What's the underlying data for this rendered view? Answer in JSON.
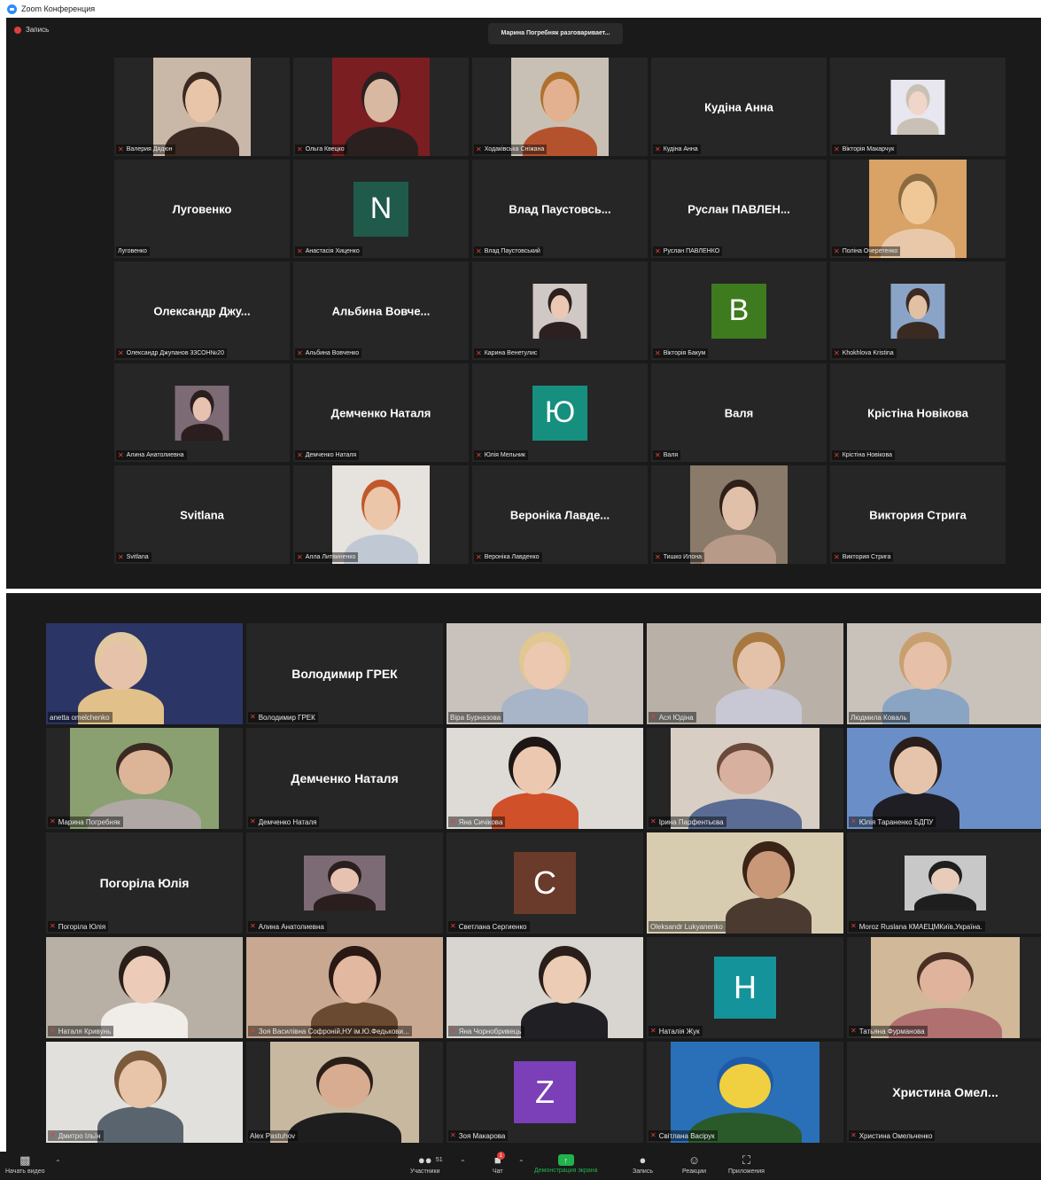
{
  "window": {
    "title": "Zoom Конференция"
  },
  "screen1": {
    "recording_label": "Запись",
    "speaking_banner": "Марина Погребняк разговаривает...",
    "tiles": [
      {
        "type": "photo",
        "name": "Валерия Дядюн",
        "bg": "#c9b8a8",
        "skin": "#e8c4a8",
        "hair": "#3a2a22"
      },
      {
        "type": "photo",
        "name": "Ольга Квецко",
        "bg": "#7a1e22",
        "skin": "#d8b8a0",
        "hair": "#2a2020"
      },
      {
        "type": "photo",
        "name": "Ходаківська Сніжана",
        "bg": "#c8c0b4",
        "skin": "#e3b190",
        "hair": "#b0702e",
        "shirt": "#b5522e"
      },
      {
        "type": "text",
        "big": "Кудіна Анна",
        "name": "Кудіна Анна"
      },
      {
        "type": "photo",
        "name": "Вікторія Макарчук",
        "bg": "#e8e6ee",
        "skin": "#f0d6c8",
        "hair": "#c9c1b5",
        "small": true
      },
      {
        "type": "text",
        "big": "Луговенко",
        "name": "Луговенко",
        "nomic": true
      },
      {
        "type": "letter",
        "letter": "N",
        "color": "#1f5a4a",
        "name": "Анастасія Хиценко"
      },
      {
        "type": "text",
        "big": "Влад Паустовсь...",
        "name": "Влад Паустовський"
      },
      {
        "type": "text",
        "big": "Руслан ПАВЛЕН...",
        "name": "Руслан ПАВЛЕНКО"
      },
      {
        "type": "photo",
        "name": "Поліна Очеретенко",
        "bg": "#d9a266",
        "skin": "#f0c898",
        "hair": "#8a6a40",
        "shirt": "#e8c8a8"
      },
      {
        "type": "text",
        "big": "Олександр Джу...",
        "name": "Олександр Джупанов 33СОН№20"
      },
      {
        "type": "text",
        "big": "Альбина Вовче...",
        "name": "Альбина Вовченко"
      },
      {
        "type": "photo",
        "name": "Карина Венетулис",
        "bg": "#d0c8c4",
        "skin": "#ecc8b4",
        "hair": "#2c2020",
        "small": true
      },
      {
        "type": "letter",
        "letter": "B",
        "color": "#3e7a1e",
        "name": "Вікторія Бакум"
      },
      {
        "type": "photo",
        "name": "Khokhlova Kristina",
        "bg": "#8aa4c8",
        "skin": "#e2c0a4",
        "hair": "#3a2a22",
        "small": true
      },
      {
        "type": "photo",
        "name": "Алина Анатолиевна",
        "bg": "#7c6a74",
        "skin": "#e8c2b0",
        "hair": "#2a1e1e",
        "small": true
      },
      {
        "type": "text",
        "big": "Демченко Наталя",
        "name": "Демченко Наталя"
      },
      {
        "type": "letter",
        "letter": "Ю",
        "color": "#168f7f",
        "name": "Юлія Мельник"
      },
      {
        "type": "text",
        "big": "Валя",
        "name": "Валя"
      },
      {
        "type": "text",
        "big": "Крістіна Новікова",
        "name": "Крістіна Новікова"
      },
      {
        "type": "text",
        "big": "Svitlana",
        "name": "Svitlana"
      },
      {
        "type": "photo",
        "name": "Алла Литвиненко",
        "bg": "#e6e2de",
        "skin": "#ecc6a8",
        "hair": "#c0582a",
        "shirt": "#c0c8d4"
      },
      {
        "type": "text",
        "big": "Вероніка Лавде...",
        "name": "Вероніка Лавденко"
      },
      {
        "type": "photo",
        "name": "Тишко Илона",
        "bg": "#8a7a6a",
        "skin": "#e0c0a8",
        "hair": "#2e2018",
        "shirt": "#b89a88"
      },
      {
        "type": "text",
        "big": "Виктория Стрига",
        "name": "Виктория Стрига"
      }
    ]
  },
  "screen2": {
    "tiles": [
      {
        "type": "video",
        "name": "anetta omelchenko",
        "nomic": true,
        "bg": "#2b3566",
        "skin": "#e6c2aa",
        "hair": "#e2c8a0",
        "shirt": "#e2c08a",
        "pos": 0.38
      },
      {
        "type": "text",
        "big": "Володимир ГРЕК",
        "name": "Володимир ГРЕК"
      },
      {
        "type": "video",
        "name": "Віра Бурназова",
        "nomic": true,
        "bg": "#c9c2bc",
        "skin": "#ecc8b0",
        "hair": "#e0c890",
        "shirt": "#a8b4c8",
        "pos": 0.5
      },
      {
        "type": "video",
        "name": "Ася Юдіна",
        "bg": "#b9b1a8",
        "skin": "#e4c2aa",
        "hair": "#a87840",
        "shirt": "#c8c8d4",
        "pos": 0.57
      },
      {
        "type": "video",
        "name": "Людмила Коваль",
        "nomic": true,
        "speaker": true,
        "bg": "#c8c2ba",
        "skin": "#e6c0a8",
        "hair": "#c8a070",
        "shirt": "#8aa4c4",
        "pos": 0.4
      },
      {
        "type": "photo",
        "name": "Марина Погребняк",
        "bg": "#8aa070",
        "skin": "#dcb498",
        "hair": "#3a2a22",
        "shirt": "#b0a8a4"
      },
      {
        "type": "text",
        "big": "Демченко Наталя",
        "name": "Демченко Наталя"
      },
      {
        "type": "video",
        "name": "Яна Сичікова",
        "bg": "#dedad6",
        "skin": "#ecc8b0",
        "hair": "#1e1614",
        "shirt": "#d0502a",
        "pos": 0.45
      },
      {
        "type": "photo",
        "name": "Ірина Парфентьєва",
        "bg": "#d8cec4",
        "skin": "#d8b0a0",
        "hair": "#6a4a3a",
        "shirt": "#5a6c94"
      },
      {
        "type": "video",
        "name": "Юлія Тараненко БДПУ",
        "bg": "#6a8ec8",
        "skin": "#e6c4ac",
        "hair": "#2a1e1a",
        "shirt": "#1e1e24",
        "pos": 0.35
      },
      {
        "type": "text",
        "big": "Погоріла Юлія",
        "name": "Погоріла Юлія"
      },
      {
        "type": "photo",
        "name": "Алина Анатолиевна",
        "bg": "#7c6a74",
        "skin": "#e8c2b0",
        "hair": "#2a1e1e",
        "small": true
      },
      {
        "type": "letter",
        "letter": "C",
        "color": "#6a3a2a",
        "name": "Светлана Сергиенко"
      },
      {
        "type": "video",
        "name": "Oleksandr Lukyanenko",
        "nomic": true,
        "bg": "#d8ccb0",
        "skin": "#c89878",
        "hair": "#3a2416",
        "shirt": "#4a3a30",
        "pos": 0.62
      },
      {
        "type": "photo",
        "name": "Moroz Ruslana КМАЕЦМКиїв,Україна.",
        "bg": "#c8c8c8",
        "skin": "#e8cbb8",
        "hair": "#1e1e1e",
        "small": true
      },
      {
        "type": "video",
        "name": "Наталя Кривунь",
        "bg": "#b8b0a4",
        "skin": "#ecccb8",
        "hair": "#2a1e1a",
        "shirt": "#f0ece8",
        "pos": 0.5
      },
      {
        "type": "video",
        "name": "Зоя Василівна Софроній,НУ ім.Ю.Федькови...",
        "bg": "#c8a890",
        "skin": "#e2b8a0",
        "hair": "#2a1814",
        "shirt": "#6a4a30",
        "pos": 0.55
      },
      {
        "type": "video",
        "name": "Яна Чорнобривець",
        "bg": "#d8d4d0",
        "skin": "#ecccb4",
        "hair": "#2a1e1a",
        "shirt": "#202024",
        "pos": 0.6
      },
      {
        "type": "letter",
        "letter": "H",
        "color": "#15939a",
        "name": "Наталія Жук"
      },
      {
        "type": "photo",
        "name": "Татьяна Фурманова",
        "bg": "#d0b898",
        "skin": "#e0b49c",
        "hair": "#4a3024",
        "shirt": "#b07070"
      },
      {
        "type": "video",
        "name": "Дмитро Ільїн",
        "bg": "#e2e0dc",
        "skin": "#e8c4a8",
        "hair": "#7a5a3a",
        "shirt": "#5a646e",
        "pos": 0.48
      },
      {
        "type": "photo",
        "name": "Alex Pastuhov",
        "nomic": true,
        "bg": "#c8b8a0",
        "skin": "#d8ac90",
        "hair": "#2a1e18",
        "shirt": "#1e1e1e"
      },
      {
        "type": "letter",
        "letter": "Z",
        "color": "#7b3fb8",
        "name": "Зоя Макарова"
      },
      {
        "type": "photo",
        "name": "Світлана Васірук",
        "bg": "#2a70b8",
        "skin": "#f0d040",
        "hair": "#1e5aa8",
        "shirt": "#2a5a2a"
      },
      {
        "type": "text",
        "big": "Христина Омел...",
        "name": "Христина Омельченко"
      }
    ]
  },
  "toolbar": {
    "start_video": "Начать видео",
    "participants": "Участники",
    "participants_count": "51",
    "chat": "Чат",
    "chat_badge": "1",
    "share": "Демонстрация экрана",
    "record": "Запись",
    "reactions": "Реакции",
    "apps": "Приложения"
  },
  "colors": {
    "background": "#1a1a1a",
    "tile": "#262626",
    "share_green": "#22b14c",
    "mic_red": "#e0403a",
    "speaker_border": "#b8e04f"
  }
}
